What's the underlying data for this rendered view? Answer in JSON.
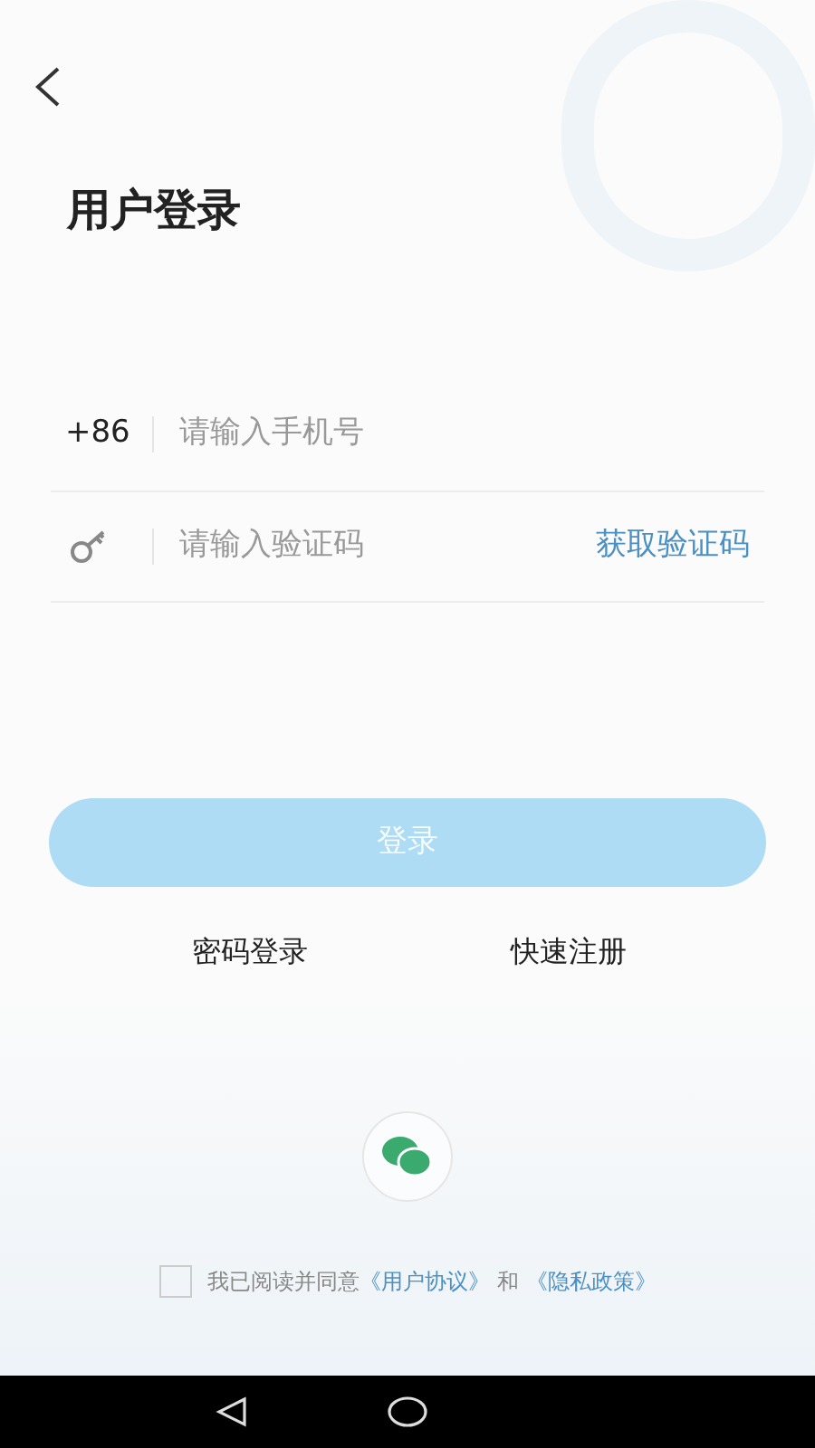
{
  "title": "用户登录",
  "phone_field": {
    "prefix": "+86",
    "placeholder": "请输入手机号"
  },
  "code_field": {
    "placeholder": "请输入验证码",
    "action": "获取验证码"
  },
  "login_button": {
    "label": "登录",
    "disabled": true
  },
  "links": [
    "密码登录",
    "快速注册"
  ],
  "agreement": {
    "checked": false,
    "text": "我已阅读并同意",
    "link_1": "《用户协议》",
    "joiner": "和",
    "link_2": "《隐私政策》"
  }
}
